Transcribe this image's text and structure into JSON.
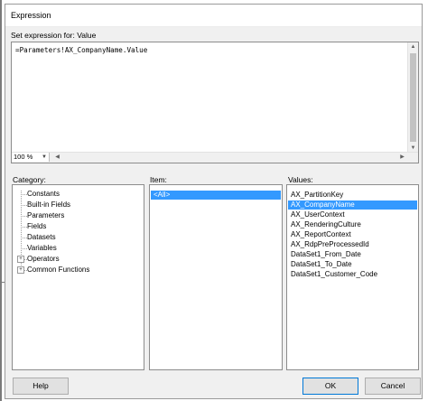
{
  "window": {
    "title": "Expression"
  },
  "expression": {
    "label": "Set expression for: Value",
    "text": "=Parameters!AX_CompanyName.Value",
    "zoom": "100 %"
  },
  "category": {
    "label": "Category:",
    "items": [
      {
        "label": "Constants"
      },
      {
        "label": "Built-in Fields"
      },
      {
        "label": "Parameters"
      },
      {
        "label": "Fields"
      },
      {
        "label": "Datasets"
      },
      {
        "label": "Variables"
      },
      {
        "label": "Operators"
      },
      {
        "label": "Common Functions"
      }
    ]
  },
  "item": {
    "label": "Item:",
    "items": [
      {
        "label": "<All>"
      }
    ],
    "selected_index": 0
  },
  "values": {
    "label": "Values:",
    "items": [
      {
        "label": "AX_PartitionKey"
      },
      {
        "label": "AX_CompanyName"
      },
      {
        "label": "AX_UserContext"
      },
      {
        "label": "AX_RenderingCulture"
      },
      {
        "label": "AX_ReportContext"
      },
      {
        "label": "AX_RdpPreProcessedId"
      },
      {
        "label": "DataSet1_From_Date"
      },
      {
        "label": "DataSet1_To_Date"
      },
      {
        "label": "DataSet1_Customer_Code"
      }
    ],
    "selected_index": 1
  },
  "buttons": {
    "help": "Help",
    "ok": "OK",
    "cancel": "Cancel"
  }
}
